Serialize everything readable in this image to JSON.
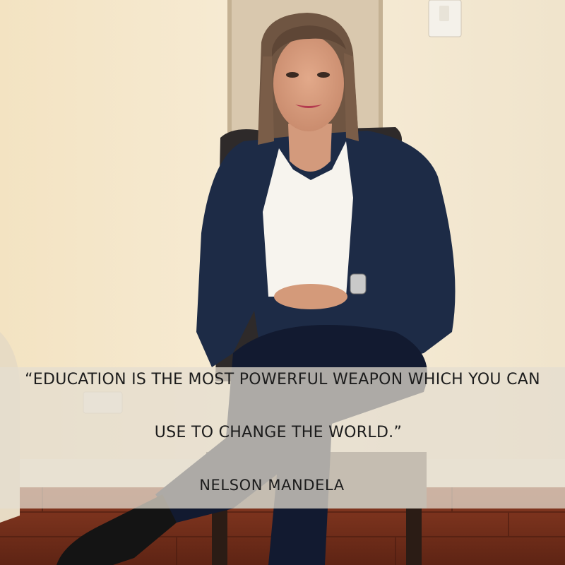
{
  "quote": {
    "line1": "“EDUCATION IS THE MOST POWERFUL WEAPON WHICH YOU CAN",
    "line2": "USE TO CHANGE THE WORLD.”",
    "author": "NELSON MANDELA"
  },
  "colors": {
    "wall": "#f2e6cc",
    "jacket": "#1c2a44",
    "blouse": "#f6f3ec",
    "floor": "#7b2f1c",
    "band": "#e4ddd0"
  }
}
